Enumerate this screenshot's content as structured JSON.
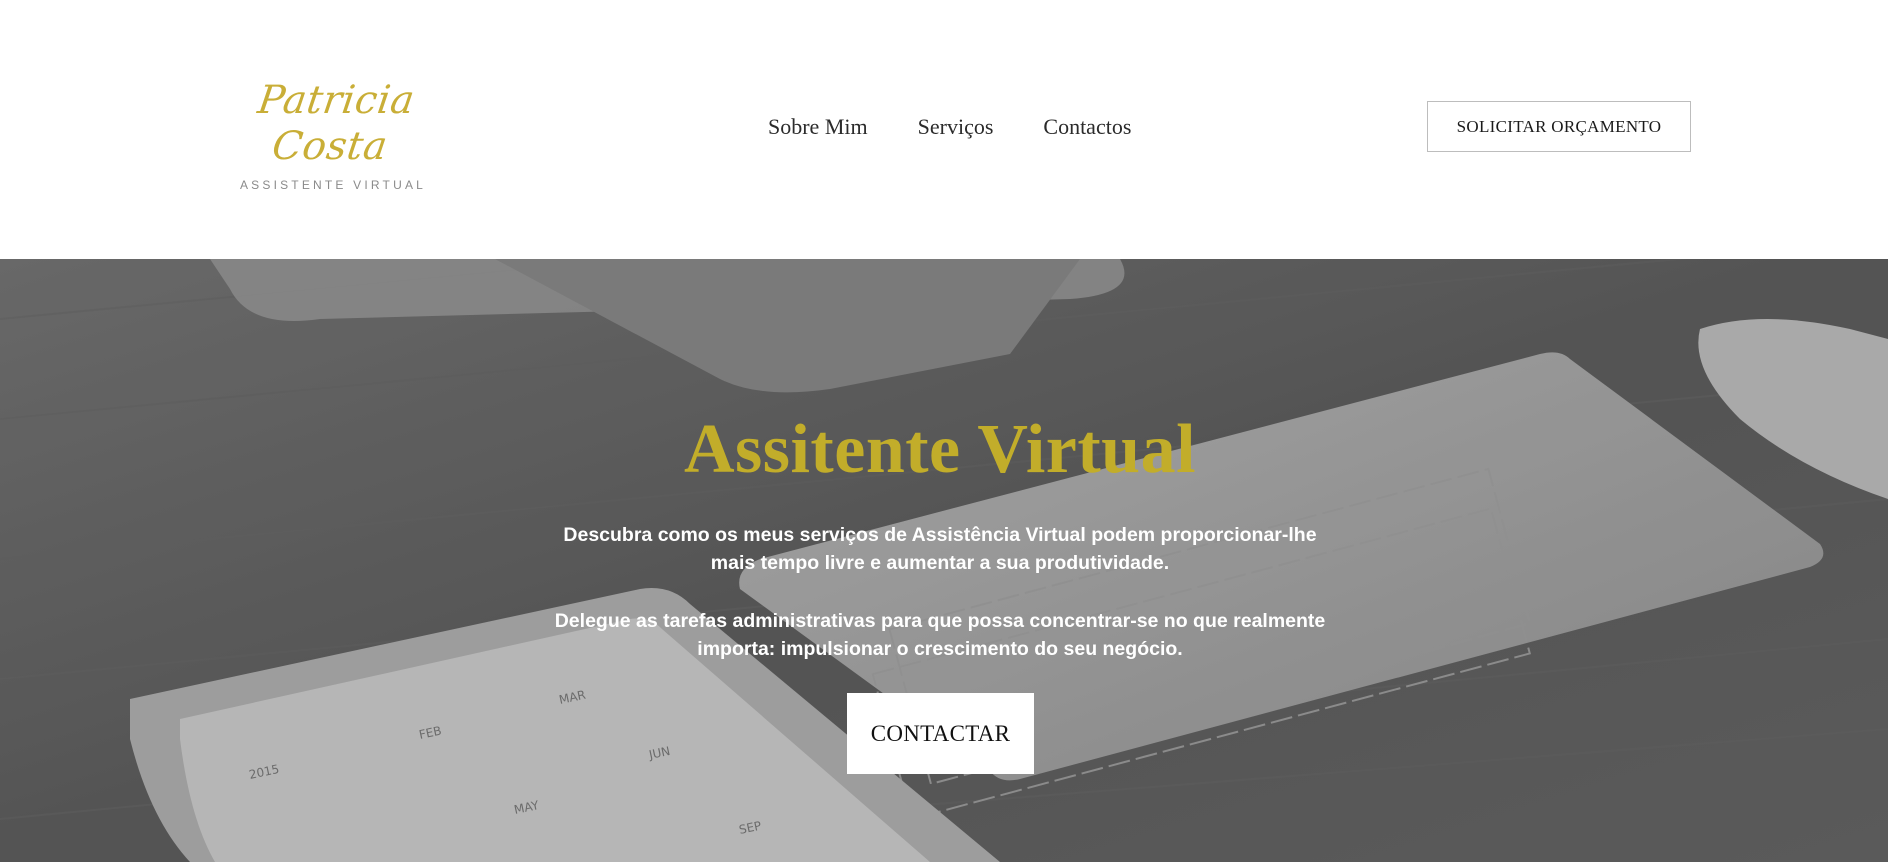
{
  "header": {
    "logo": {
      "name": "Patricia Costa",
      "tagline": "ASSISTENTE VIRTUAL"
    },
    "nav": [
      {
        "label": "Sobre Mim"
      },
      {
        "label": "Serviços"
      },
      {
        "label": "Contactos"
      }
    ],
    "cta_label": "SOLICITAR ORÇAMENTO"
  },
  "hero": {
    "title": "Assitente Virtual",
    "paragraph_1": "Descubra como os meus serviços de Assistência Virtual podem proporcionar-lhe mais tempo livre e aumentar a sua produtividade.",
    "paragraph_2": "Delegue as tarefas administrativas para que possa concentrar-se no que realmente importa: impulsionar o crescimento do seu negócio.",
    "button_label": "CONTACTAR",
    "background_image": "grayscale desk photo: monitor stand, wireless keyboard, mouse, tablet with 2015 calendar"
  },
  "colors": {
    "accent_gold": "#c2ad2a",
    "logo_gold": "#c9ae37",
    "text_dark": "#2b2b2b",
    "hero_text": "#ffffff"
  }
}
